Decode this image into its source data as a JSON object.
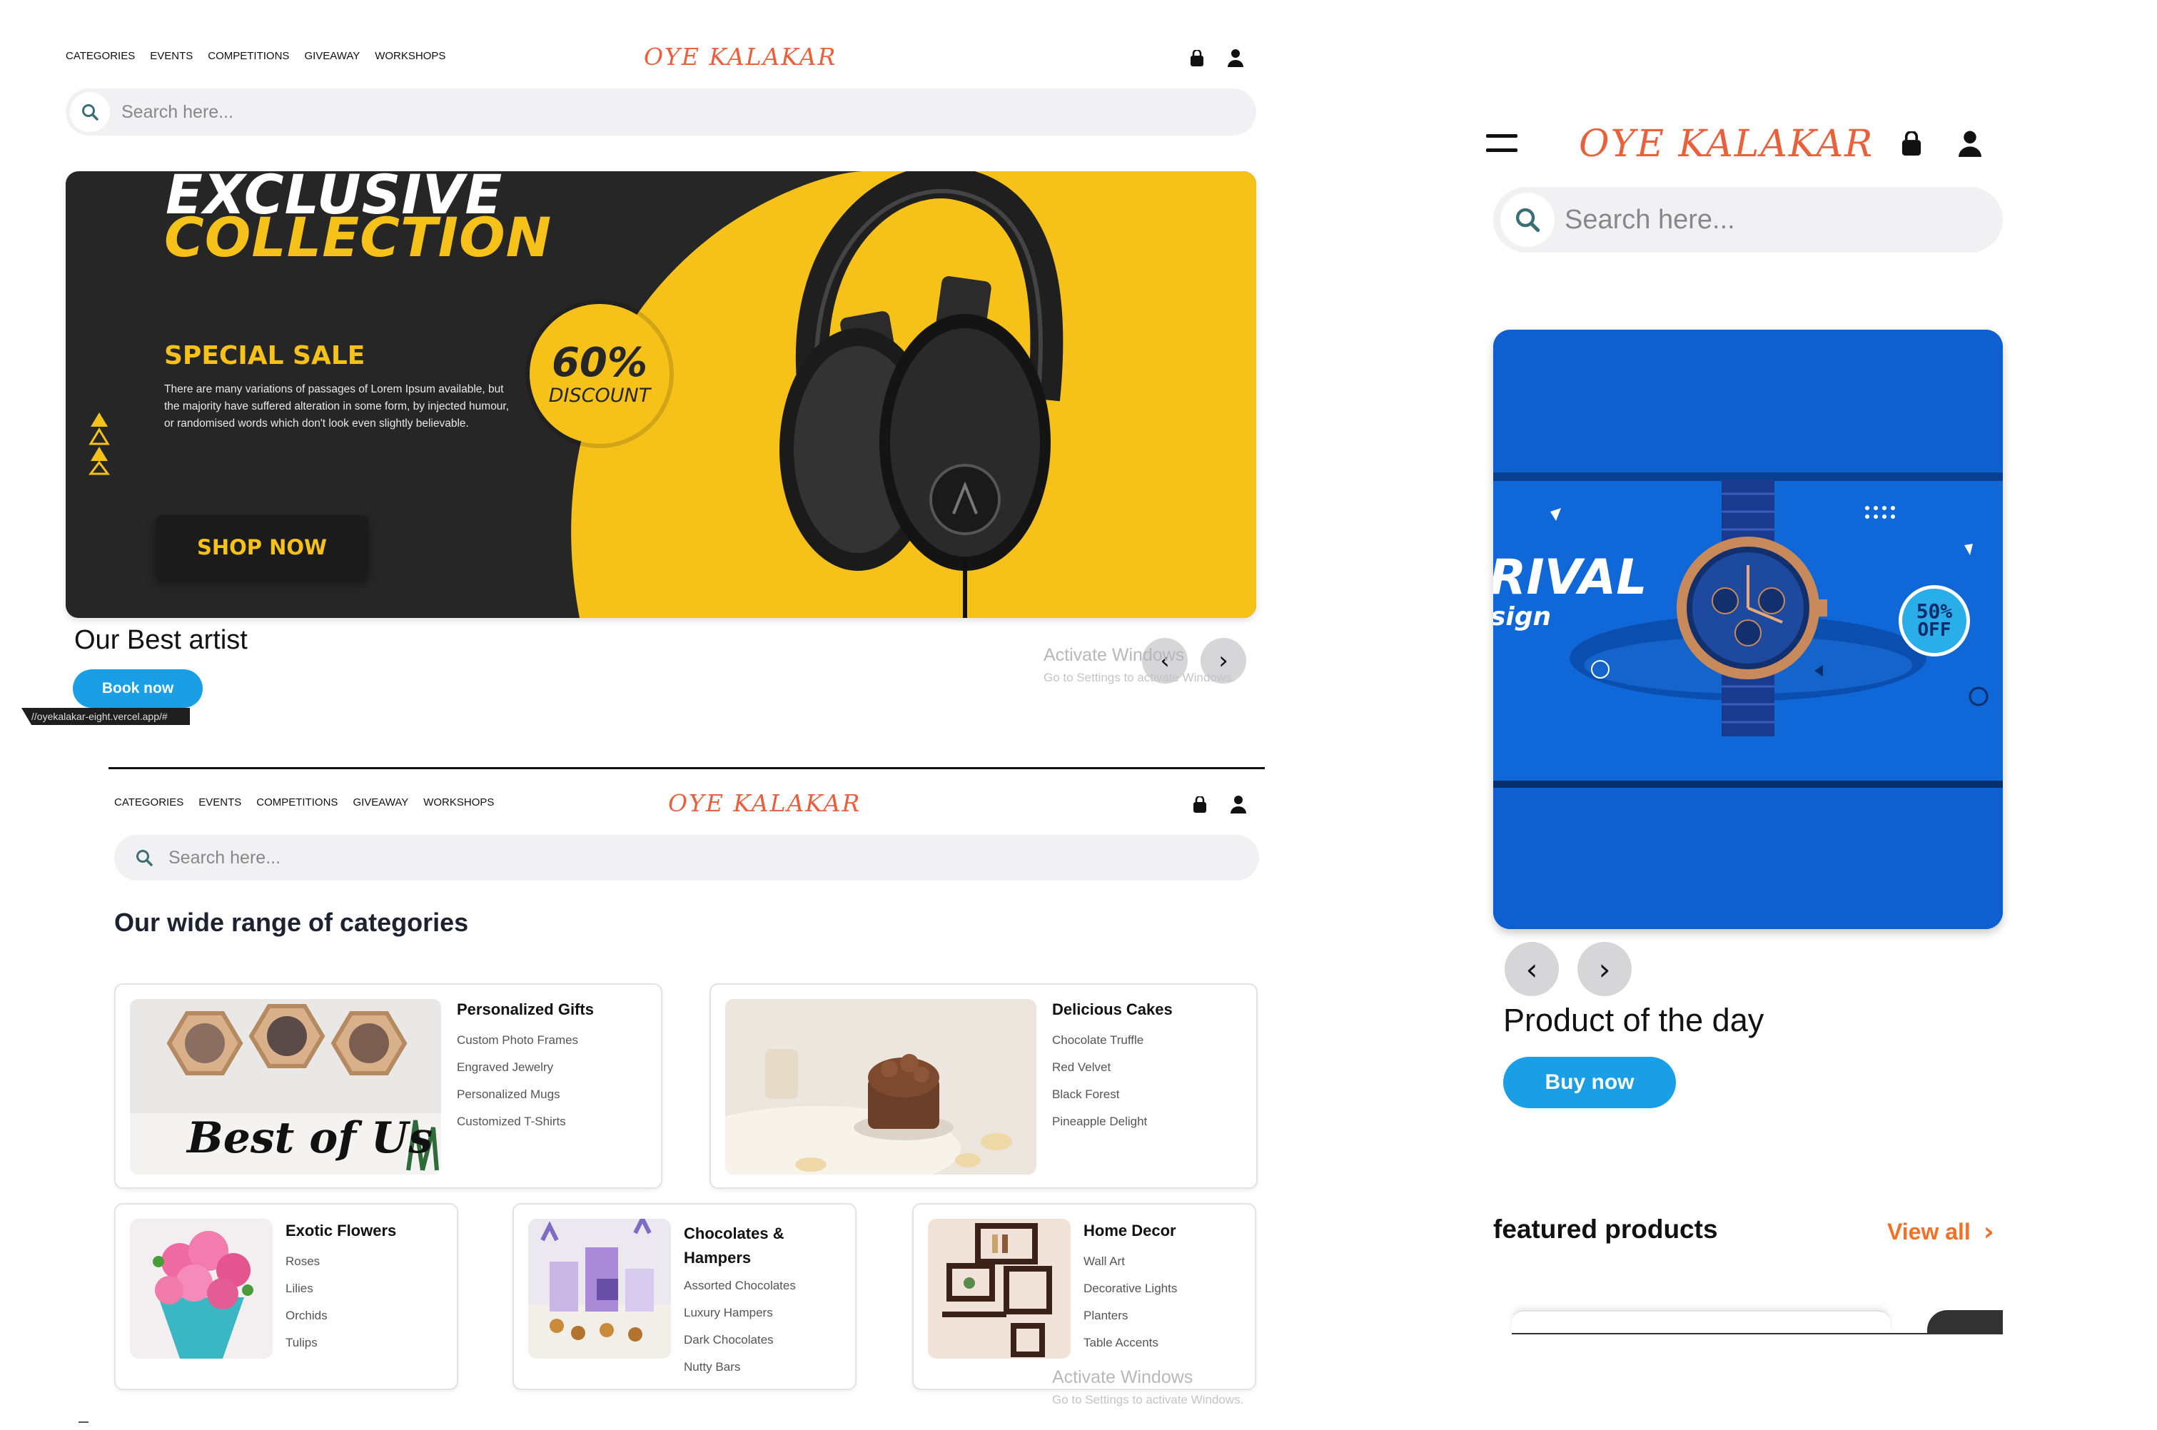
{
  "desktop_top": {
    "nav": [
      "CATEGORIES",
      "EVENTS",
      "COMPETITIONS",
      "GIVEAWAY",
      "WORKSHOPS"
    ],
    "logo": "OYE KALAKAR",
    "search_placeholder": "Search here...",
    "banner": {
      "headline1": "EXCLUSIVE",
      "headline2": "COLLECTION",
      "special": "SPECIAL SALE",
      "desc": "There are many variations of passages of Lorem Ipsum available, but the majority have suffered alteration in some form, by injected humour, or randomised words which don't look even slightly believable.",
      "discount_pct": "60%",
      "discount_text": "DISCOUNT",
      "cta": "SHOP NOW"
    },
    "artist_title": "Our Best artist",
    "book_now": "Book now",
    "status_url": "//oyekalakar-eight.vercel.app/#",
    "watermark_line1": "Activate Windows",
    "watermark_line2": "Go to Settings to activate Windows."
  },
  "desktop_bottom": {
    "nav": [
      "CATEGORIES",
      "EVENTS",
      "COMPETITIONS",
      "GIVEAWAY",
      "WORKSHOPS"
    ],
    "logo": "OYE KALAKAR",
    "search_placeholder": "Search here...",
    "section_title": "Our wide range of categories",
    "categories": [
      {
        "title": "Personalized Gifts",
        "items": [
          "Custom Photo Frames",
          "Engraved Jewelry",
          "Personalized Mugs",
          "Customized T-Shirts"
        ],
        "image_text": "Best of Us"
      },
      {
        "title": "Delicious Cakes",
        "items": [
          "Chocolate Truffle",
          "Red Velvet",
          "Black Forest",
          "Pineapple Delight"
        ]
      },
      {
        "title": "Exotic Flowers",
        "items": [
          "Roses",
          "Lilies",
          "Orchids",
          "Tulips"
        ]
      },
      {
        "title": "Chocolates & Hampers",
        "items": [
          "Assorted Chocolates",
          "Luxury Hampers",
          "Dark Chocolates",
          "Nutty Bars"
        ]
      },
      {
        "title": "Home Decor",
        "items": [
          "Wall Art",
          "Decorative Lights",
          "Planters",
          "Table Accents"
        ]
      }
    ],
    "watermark_line1": "Activate Windows",
    "watermark_line2": "Go to Settings to activate Windows."
  },
  "mobile": {
    "logo": "OYE KALAKAR",
    "search_placeholder": "Search here...",
    "banner": {
      "headline": "RIVAL",
      "subline": "sign",
      "badge_pct": "50%",
      "badge_text": "OFF"
    },
    "product_title": "Product of the day",
    "buy_now": "Buy now",
    "featured": "featured products",
    "view_all": "View all"
  },
  "colors": {
    "accent_blue": "#1a9fe6",
    "logo": "#e8603c",
    "yellow": "#f6c21a",
    "view_all": "#f07127"
  },
  "icons": [
    "bag-icon",
    "user-icon",
    "search-icon",
    "menu-icon",
    "chevron-left-icon",
    "chevron-right-icon"
  ]
}
